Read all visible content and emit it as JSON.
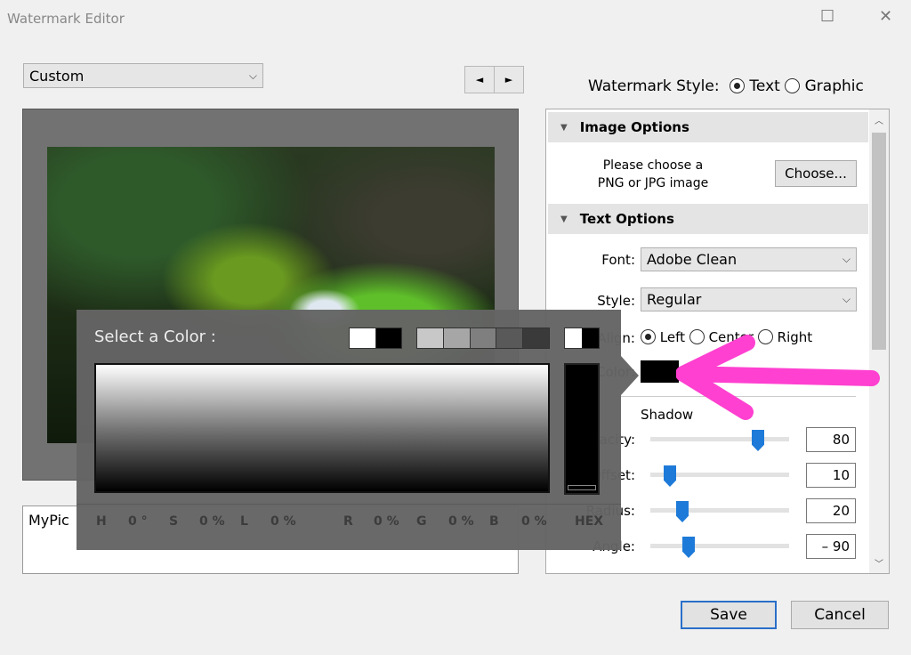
{
  "window": {
    "title": "Watermark Editor"
  },
  "preset": {
    "value": "Custom"
  },
  "nav": {
    "prev": "◄",
    "next": "►"
  },
  "style": {
    "label": "Watermark Style:",
    "text": "Text",
    "graphic": "Graphic",
    "selected": "Text"
  },
  "image_options": {
    "header": "Image Options",
    "hint_line1": "Please choose a",
    "hint_line2": "PNG or JPG image",
    "choose": "Choose..."
  },
  "text_options": {
    "header": "Text Options",
    "font_label": "Font:",
    "font": "Adobe Clean",
    "style_label": "Style:",
    "style": "Regular",
    "align_label": "Align:",
    "align_options": [
      "Left",
      "Center",
      "Right"
    ],
    "align_selected": "Left",
    "color_label": "Color:",
    "color": "#000000"
  },
  "shadow": {
    "header": "Shadow",
    "opacity_label": "Opacity:",
    "opacity": "80",
    "offset_label": "Offset:",
    "offset": "10",
    "radius_label": "Radius:",
    "radius": "20",
    "angle_label": "Angle:",
    "angle": "– 90"
  },
  "watermark_text": "MyPic",
  "color_picker": {
    "title": "Select a Color :",
    "h_label": "H",
    "h": "0 °",
    "s_label": "S",
    "s": "0 %",
    "l_label": "L",
    "l": "0 %",
    "r_label": "R",
    "r": "0 %",
    "g_label": "G",
    "g": "0 %",
    "b_label": "B",
    "b": "0 %",
    "hex_label": "HEX",
    "swatches": [
      "#ffffff",
      "#000000",
      "#c8c8c8",
      "#a6a6a6",
      "#7f7f7f",
      "#595959",
      "#3a3a3a"
    ]
  },
  "annotation_color": "#ff40d0",
  "footer": {
    "save": "Save",
    "cancel": "Cancel"
  }
}
